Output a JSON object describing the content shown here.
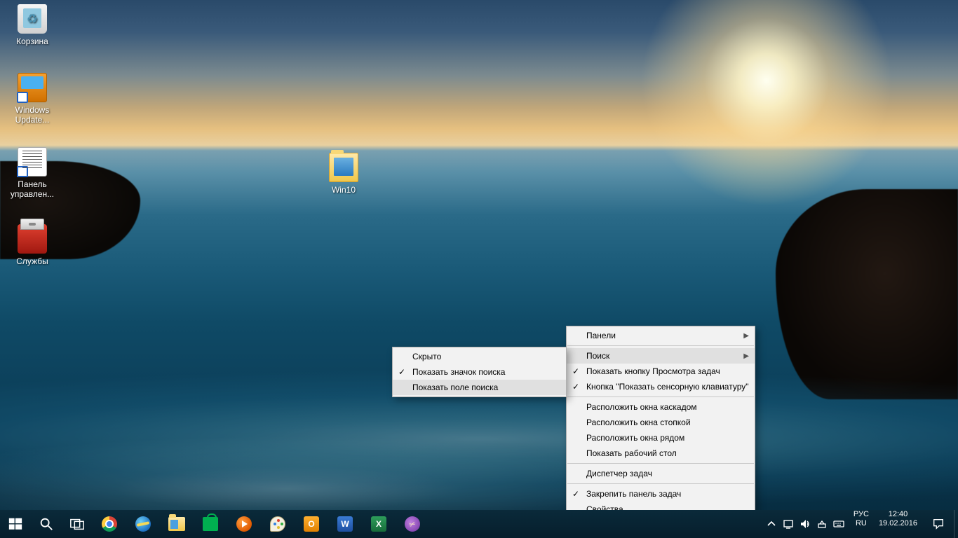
{
  "desktop_icons": {
    "recycle": "Корзина",
    "wupdate": "Windows Update...",
    "panel": "Панель управлен...",
    "services": "Службы",
    "win10_folder": "Win10"
  },
  "context_menu_main": {
    "items": [
      {
        "label": "Панели",
        "arrow": true
      },
      {
        "sep": true
      },
      {
        "label": "Поиск",
        "arrow": true,
        "hover": true
      },
      {
        "label": "Показать кнопку Просмотра задач",
        "check": true
      },
      {
        "label": "Кнопка \"Показать сенсорную клавиатуру\"",
        "check": true
      },
      {
        "sep": true
      },
      {
        "label": "Расположить окна каскадом"
      },
      {
        "label": "Расположить окна стопкой"
      },
      {
        "label": "Расположить окна рядом"
      },
      {
        "label": "Показать рабочий стол"
      },
      {
        "sep": true
      },
      {
        "label": "Диспетчер задач"
      },
      {
        "sep": true
      },
      {
        "label": "Закрепить панель задач",
        "check": true
      },
      {
        "label": "Свойства"
      }
    ]
  },
  "context_menu_sub": {
    "items": [
      {
        "label": "Скрыто"
      },
      {
        "label": "Показать значок поиска",
        "check": true
      },
      {
        "label": "Показать поле поиска",
        "hover": true
      }
    ]
  },
  "tray": {
    "lang1": "РУС",
    "lang2": "RU",
    "time": "12:40",
    "date": "19.02.2016"
  },
  "office": {
    "o": "O",
    "w": "W",
    "x": "X"
  }
}
